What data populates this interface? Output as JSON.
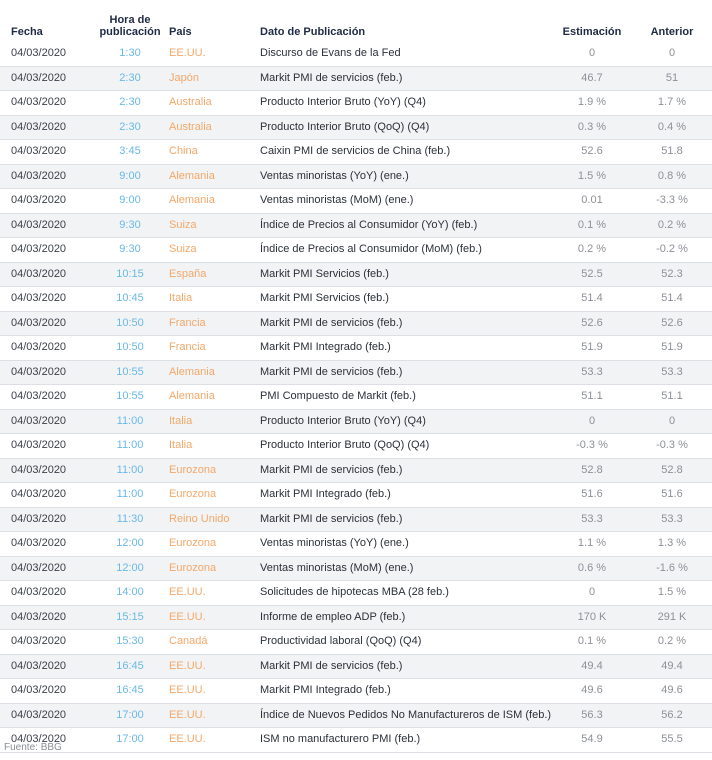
{
  "headers": {
    "date": "Fecha",
    "time_line1": "Hora de",
    "time_line2": "publicación",
    "country": "País",
    "event": "Dato de Publicación",
    "estimate": "Estimación",
    "previous": "Anterior"
  },
  "rows": [
    {
      "date": "04/03/2020",
      "time": "1:30",
      "country": "EE.UU.",
      "event": "Discurso de Evans de la Fed",
      "estimate": "0",
      "previous": "0"
    },
    {
      "date": "04/03/2020",
      "time": "2:30",
      "country": "Japón",
      "event": "Markit PMI de servicios (feb.)",
      "estimate": "46.7",
      "previous": "51"
    },
    {
      "date": "04/03/2020",
      "time": "2:30",
      "country": "Australia",
      "event": "Producto Interior Bruto (YoY) (Q4)",
      "estimate": "1.9 %",
      "previous": "1.7 %"
    },
    {
      "date": "04/03/2020",
      "time": "2:30",
      "country": "Australia",
      "event": "Producto Interior Bruto (QoQ) (Q4)",
      "estimate": "0.3 %",
      "previous": "0.4 %"
    },
    {
      "date": "04/03/2020",
      "time": "3:45",
      "country": "China",
      "event": "Caixin PMI de servicios de China (feb.)",
      "estimate": "52.6",
      "previous": "51.8"
    },
    {
      "date": "04/03/2020",
      "time": "9:00",
      "country": "Alemania",
      "event": "Ventas minoristas (YoY) (ene.)",
      "estimate": "1.5 %",
      "previous": "0.8 %"
    },
    {
      "date": "04/03/2020",
      "time": "9:00",
      "country": "Alemania",
      "event": "Ventas minoristas (MoM) (ene.)",
      "estimate": "0.01",
      "previous": "-3.3 %"
    },
    {
      "date": "04/03/2020",
      "time": "9:30",
      "country": "Suiza",
      "event": "Índice de Precios al Consumidor (YoY) (feb.)",
      "estimate": "0.1 %",
      "previous": "0.2 %"
    },
    {
      "date": "04/03/2020",
      "time": "9:30",
      "country": "Suiza",
      "event": "Índice de Precios al Consumidor (MoM) (feb.)",
      "estimate": "0.2 %",
      "previous": "-0.2 %"
    },
    {
      "date": "04/03/2020",
      "time": "10:15",
      "country": "España",
      "event": "Markit PMI Servicios (feb.)",
      "estimate": "52.5",
      "previous": "52.3"
    },
    {
      "date": "04/03/2020",
      "time": "10:45",
      "country": "Italia",
      "event": "Markit PMI Servicios (feb.)",
      "estimate": "51.4",
      "previous": "51.4"
    },
    {
      "date": "04/03/2020",
      "time": "10:50",
      "country": "Francia",
      "event": "Markit PMI de servicios (feb.)",
      "estimate": "52.6",
      "previous": "52.6"
    },
    {
      "date": "04/03/2020",
      "time": "10:50",
      "country": "Francia",
      "event": "Markit PMI Integrado (feb.)",
      "estimate": "51.9",
      "previous": "51.9"
    },
    {
      "date": "04/03/2020",
      "time": "10:55",
      "country": "Alemania",
      "event": "Markit PMI de servicios (feb.)",
      "estimate": "53.3",
      "previous": "53.3"
    },
    {
      "date": "04/03/2020",
      "time": "10:55",
      "country": "Alemania",
      "event": "PMI Compuesto de Markit (feb.)",
      "estimate": "51.1",
      "previous": "51.1"
    },
    {
      "date": "04/03/2020",
      "time": "11:00",
      "country": "Italia",
      "event": "Producto Interior Bruto (YoY) (Q4)",
      "estimate": "0",
      "previous": "0"
    },
    {
      "date": "04/03/2020",
      "time": "11:00",
      "country": "Italia",
      "event": "Producto Interior Bruto (QoQ) (Q4)",
      "estimate": "-0.3 %",
      "previous": "-0.3 %"
    },
    {
      "date": "04/03/2020",
      "time": "11:00",
      "country": "Eurozona",
      "event": "Markit PMI de servicios (feb.)",
      "estimate": "52.8",
      "previous": "52.8"
    },
    {
      "date": "04/03/2020",
      "time": "11:00",
      "country": "Eurozona",
      "event": "Markit PMI Integrado (feb.)",
      "estimate": "51.6",
      "previous": "51.6"
    },
    {
      "date": "04/03/2020",
      "time": "11:30",
      "country": "Reino Unido",
      "event": "Markit PMI de servicios (feb.)",
      "estimate": "53.3",
      "previous": "53.3"
    },
    {
      "date": "04/03/2020",
      "time": "12:00",
      "country": "Eurozona",
      "event": "Ventas minoristas (YoY) (ene.)",
      "estimate": "1.1 %",
      "previous": "1.3 %"
    },
    {
      "date": "04/03/2020",
      "time": "12:00",
      "country": "Eurozona",
      "event": "Ventas minoristas (MoM) (ene.)",
      "estimate": "0.6 %",
      "previous": "-1.6 %"
    },
    {
      "date": "04/03/2020",
      "time": "14:00",
      "country": "EE.UU.",
      "event": "Solicitudes de hipotecas MBA (28 feb.)",
      "estimate": "0",
      "previous": "1.5 %"
    },
    {
      "date": "04/03/2020",
      "time": "15:15",
      "country": "EE.UU.",
      "event": "Informe de empleo ADP (feb.)",
      "estimate": "170 K",
      "previous": "291 K"
    },
    {
      "date": "04/03/2020",
      "time": "15:30",
      "country": "Canadá",
      "event": "Productividad laboral (QoQ) (Q4)",
      "estimate": "0.1 %",
      "previous": "0.2 %"
    },
    {
      "date": "04/03/2020",
      "time": "16:45",
      "country": "EE.UU.",
      "event": "Markit PMI de servicios (feb.)",
      "estimate": "49.4",
      "previous": "49.4"
    },
    {
      "date": "04/03/2020",
      "time": "16:45",
      "country": "EE.UU.",
      "event": "Markit PMI Integrado (feb.)",
      "estimate": "49.6",
      "previous": "49.6"
    },
    {
      "date": "04/03/2020",
      "time": "17:00",
      "country": "EE.UU.",
      "event": "Índice de Nuevos Pedidos No Manufactureros de ISM (feb.)",
      "estimate": "56.3",
      "previous": "56.2"
    },
    {
      "date": "04/03/2020",
      "time": "17:00",
      "country": "EE.UU.",
      "event": "ISM no manufacturero PMI (feb.)",
      "estimate": "54.9",
      "previous": "55.5"
    }
  ],
  "source": "Fuente: BBG",
  "colors": {
    "time": "#69b9e6",
    "country": "#f3a86a",
    "header": "#1f2a44",
    "row_alt": "#f2f3f5"
  }
}
